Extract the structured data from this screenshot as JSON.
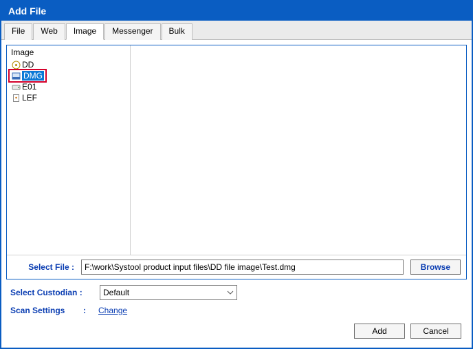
{
  "window": {
    "title": "Add File"
  },
  "tabs": {
    "file": "File",
    "web": "Web",
    "image": "Image",
    "messenger": "Messenger",
    "bulk": "Bulk"
  },
  "image_panel": {
    "heading": "Image",
    "items": {
      "dd": "DD",
      "dmg": "DMG",
      "e01": "E01",
      "lef": "LEF"
    }
  },
  "select_file": {
    "label": "Select File :",
    "value": "F:\\work\\Systool product input files\\DD file image\\Test.dmg",
    "browse": "Browse"
  },
  "custodian": {
    "label": "Select Custodian :",
    "value": "Default"
  },
  "scan_settings": {
    "label": "Scan Settings",
    "colon": ":",
    "change": "Change"
  },
  "buttons": {
    "add": "Add",
    "cancel": "Cancel"
  }
}
